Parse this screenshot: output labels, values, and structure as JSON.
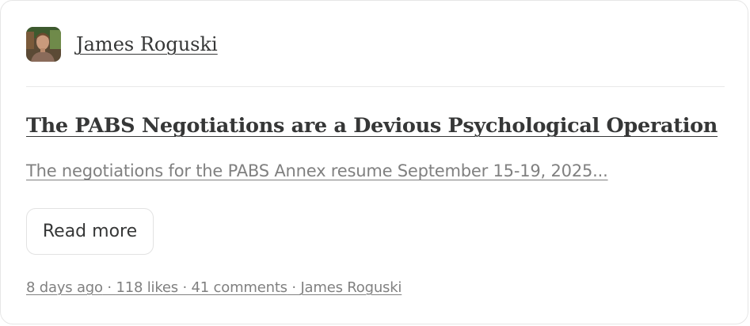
{
  "author": {
    "name": "James Roguski",
    "avatar_icon": "author-avatar-photo"
  },
  "post": {
    "title": "The PABS Negotiations are a Devious Psychological Operation",
    "subtitle": "The negotiations for the PABS Annex resume September 15-19, 2025...",
    "read_more_label": "Read more"
  },
  "meta": {
    "age": "8 days ago",
    "separator": " · ",
    "likes": "118 likes",
    "comments": "41 comments",
    "author": "James Roguski"
  },
  "colors": {
    "text_primary": "#363737",
    "text_secondary": "#808080",
    "border": "#e6e6e6"
  }
}
